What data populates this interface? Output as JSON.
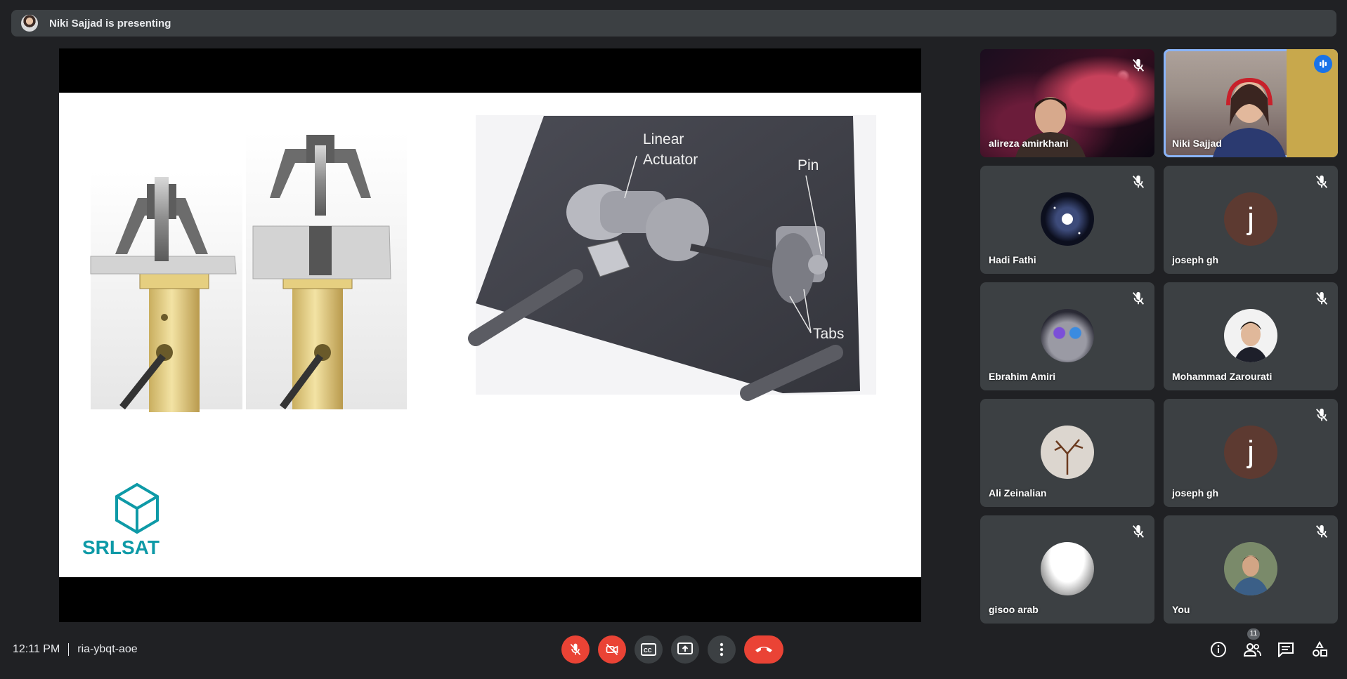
{
  "presenting_banner": {
    "text": "Niki Sajjad is presenting"
  },
  "slide": {
    "labels": {
      "linear": "Linear",
      "actuator": "Actuator",
      "pin": "Pin",
      "tabs": "Tabs"
    },
    "logo_text": "SRLSAT"
  },
  "participants": [
    {
      "name": "alireza amirkhani",
      "muted": true
    },
    {
      "name": "Niki Sajjad",
      "speaking": true
    },
    {
      "name": "Hadi Fathi",
      "muted": true
    },
    {
      "name": "joseph gh",
      "muted": true,
      "initial": "j"
    },
    {
      "name": "Ebrahim Amiri",
      "muted": true
    },
    {
      "name": "Mohammad Zarourati",
      "muted": true
    },
    {
      "name": "Ali Zeinalian"
    },
    {
      "name": "joseph gh",
      "muted": true,
      "initial": "j"
    },
    {
      "name": "gisoo arab",
      "muted": true
    },
    {
      "name": "You",
      "muted": true
    }
  ],
  "footer": {
    "time": "12:11 PM",
    "meeting_code": "ria-ybqt-aoe",
    "participant_count": "11"
  },
  "colors": {
    "accent_blue": "#1a73e8",
    "danger_red": "#ea4335",
    "tile_bg": "#3c4043",
    "page_bg": "#202124"
  }
}
